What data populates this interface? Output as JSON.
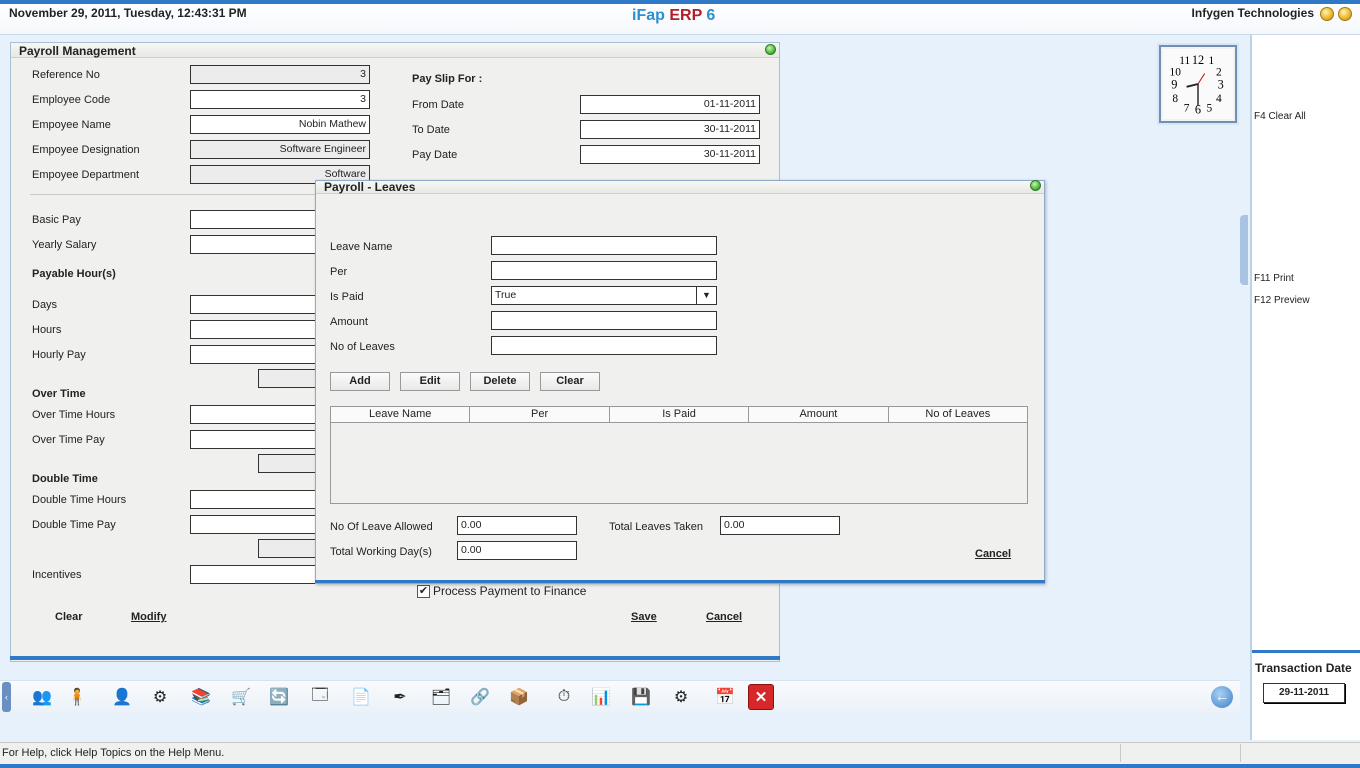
{
  "header": {
    "datetime": "November  29, 2011, Tuesday, 12:43:31 PM",
    "brand": {
      "part1": "iFap ",
      "part2": "ERP",
      "part3": " 6"
    },
    "company": "Infygen Technologies"
  },
  "side": {
    "clear_all": "F4 Clear All",
    "print": "F11 Print",
    "preview": "F12 Preview",
    "transaction_date_label": "Transaction Date",
    "transaction_date": "29-11-2011"
  },
  "payroll": {
    "title": "Payroll Management",
    "reference_no_label": "Reference No",
    "reference_no": "3",
    "employee_code_label": "Employee Code",
    "employee_code": "3",
    "employee_name_label": "Empoyee Name",
    "employee_name": "Nobin Mathew",
    "designation_label": "Empoyee Designation",
    "designation": "Software Engineer",
    "department_label": "Empoyee Department",
    "department": "Software",
    "payslip_label": "Pay Slip For :",
    "from_date_label": "From Date",
    "from_date": "01-11-2011",
    "to_date_label": "To Date",
    "to_date": "30-11-2011",
    "pay_date_label": "Pay Date",
    "pay_date": "30-11-2011",
    "basic_pay_label": "Basic Pay",
    "yearly_salary_label": "Yearly Salary",
    "payable_hours_label": "Payable Hour(s)",
    "days_label": "Days",
    "hours_label": "Hours",
    "hourly_pay_label": "Hourly Pay",
    "over_time_label": "Over Time",
    "over_time_hours_label": "Over Time Hours",
    "over_time_pay_label": "Over Time Pay",
    "double_time_label": "Double Time",
    "double_time_hours_label": "Double Time Hours",
    "double_time_pay_label": "Double Time Pay",
    "incentives_label": "Incentives",
    "process_payment_label": "Process Payment to Finance",
    "process_payment_checked": true,
    "clear_btn": "Clear",
    "modify_btn": "Modify",
    "save_btn": "Save",
    "cancel_btn": "Cancel"
  },
  "leaves": {
    "title": "Payroll - Leaves",
    "leave_name_label": "Leave Name",
    "leave_name": "",
    "per_label": "Per",
    "per": "",
    "is_paid_label": "Is Paid",
    "is_paid": "True",
    "amount_label": "Amount",
    "amount": "",
    "no_of_leaves_label": "No of Leaves",
    "no_of_leaves": "",
    "add_btn": "Add",
    "edit_btn": "Edit",
    "delete_btn": "Delete",
    "clear_btn": "Clear",
    "columns": [
      "Leave Name",
      "Per",
      "Is Paid",
      "Amount",
      "No of Leaves"
    ],
    "leave_allowed_label": "No Of Leave Allowed",
    "leave_allowed": "0.00",
    "total_taken_label": "Total Leaves Taken",
    "total_taken": "0.00",
    "working_days_label": "Total Working Day(s)",
    "working_days": "0.00",
    "cancel_btn": "Cancel"
  },
  "toolbar": {
    "icons": [
      "users-icon",
      "person-icon",
      "employee-icon",
      "network-icon",
      "books-icon",
      "cart-icon",
      "refresh-icon",
      "window-icon",
      "document-icon",
      "pen-icon",
      "tree-icon",
      "share-icon",
      "box-icon",
      "timer-icon",
      "report-icon",
      "save-disk-icon",
      "settings-icon",
      "calendar-icon",
      "close-icon"
    ]
  },
  "status": {
    "text": "For Help, click Help Topics on the Help Menu."
  },
  "colors": {
    "accent": "#2f79c6",
    "brand_blue": "#2b8fd6",
    "brand_red": "#b21e28"
  }
}
